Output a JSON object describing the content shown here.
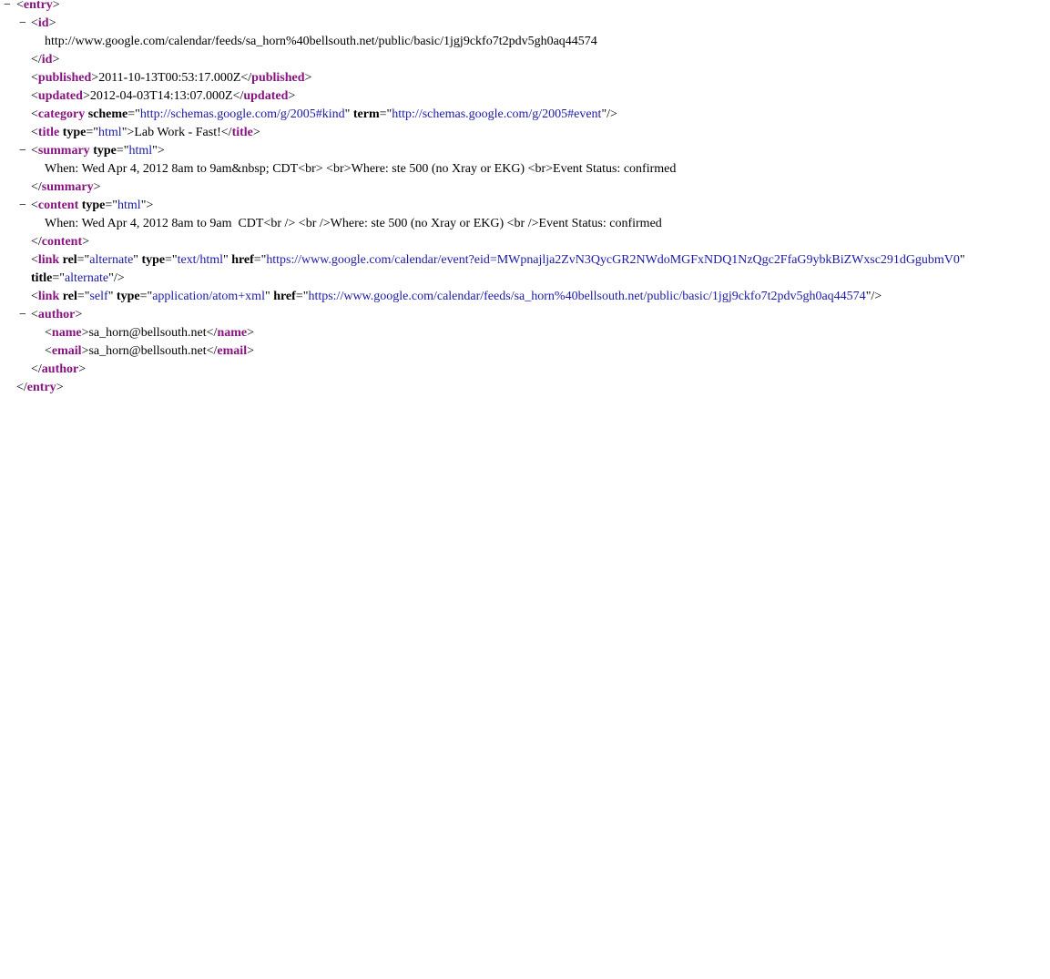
{
  "toggle_symbol": "−",
  "entry": {
    "tag": "entry",
    "id": {
      "tag": "id",
      "text": "http://www.google.com/calendar/feeds/sa_horn%40bellsouth.net/public/basic/1jgj9ckfo7t2pdv5gh0aq44574"
    },
    "published": {
      "tag": "published",
      "text": "2011-10-13T00:53:17.000Z"
    },
    "updated": {
      "tag": "updated",
      "text": "2012-04-03T14:13:07.000Z"
    },
    "category": {
      "tag": "category",
      "scheme_attr": "scheme",
      "scheme_val": "http://schemas.google.com/g/2005#kind",
      "term_attr": "term",
      "term_val": "http://schemas.google.com/g/2005#event"
    },
    "title": {
      "tag": "title",
      "type_attr": "type",
      "type_val": "html",
      "text": "Lab Work - Fast!"
    },
    "summary": {
      "tag": "summary",
      "type_attr": "type",
      "type_val": "html",
      "text": "When: Wed Apr 4, 2012 8am to 9am&nbsp; CDT<br> <br>Where: ste 500 (no Xray or EKG) <br>Event Status: confirmed"
    },
    "content": {
      "tag": "content",
      "type_attr": "type",
      "type_val": "html",
      "text": "When: Wed Apr 4, 2012 8am to 9am  CDT<br /> <br />Where: ste 500 (no Xray or EKG) <br />Event Status: confirmed"
    },
    "link_alternate": {
      "tag": "link",
      "rel_attr": "rel",
      "rel_val": "alternate",
      "type_attr": "type",
      "type_val": "text/html",
      "href_attr": "href",
      "href_val": "https://www.google.com/calendar/event?eid=MWpnajlja2ZvN3QycGR2NWdoMGFxNDQ1NzQgc2FfaG9ybkBiZWxsc291dGgubmV0",
      "title_attr": "title",
      "title_val": "alternate"
    },
    "link_self": {
      "tag": "link",
      "rel_attr": "rel",
      "rel_val": "self",
      "type_attr": "type",
      "type_val": "application/atom+xml",
      "href_attr": "href",
      "href_val": "https://www.google.com/calendar/feeds/sa_horn%40bellsouth.net/public/basic/1jgj9ckfo7t2pdv5gh0aq44574"
    },
    "author": {
      "tag": "author",
      "name_tag": "name",
      "name_text": "sa_horn@bellsouth.net",
      "email_tag": "email",
      "email_text": "sa_horn@bellsouth.net"
    }
  }
}
